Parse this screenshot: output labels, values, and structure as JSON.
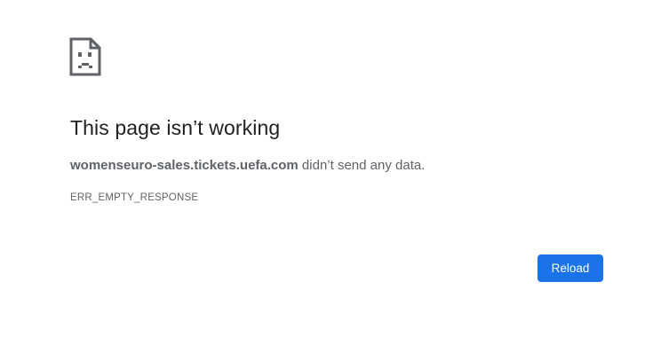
{
  "error_page": {
    "icon": "sad-page-icon",
    "headline": "This page isn’t working",
    "host": "womenseuro-sales.tickets.uefa.com",
    "message_suffix": " didn’t send any data.",
    "error_code": "ERR_EMPTY_RESPONSE",
    "reload_label": "Reload"
  },
  "colors": {
    "background": "#ffffff",
    "headline": "#202124",
    "body_text": "#5f6368",
    "button": "#1a73e8",
    "button_text": "#ffffff"
  }
}
